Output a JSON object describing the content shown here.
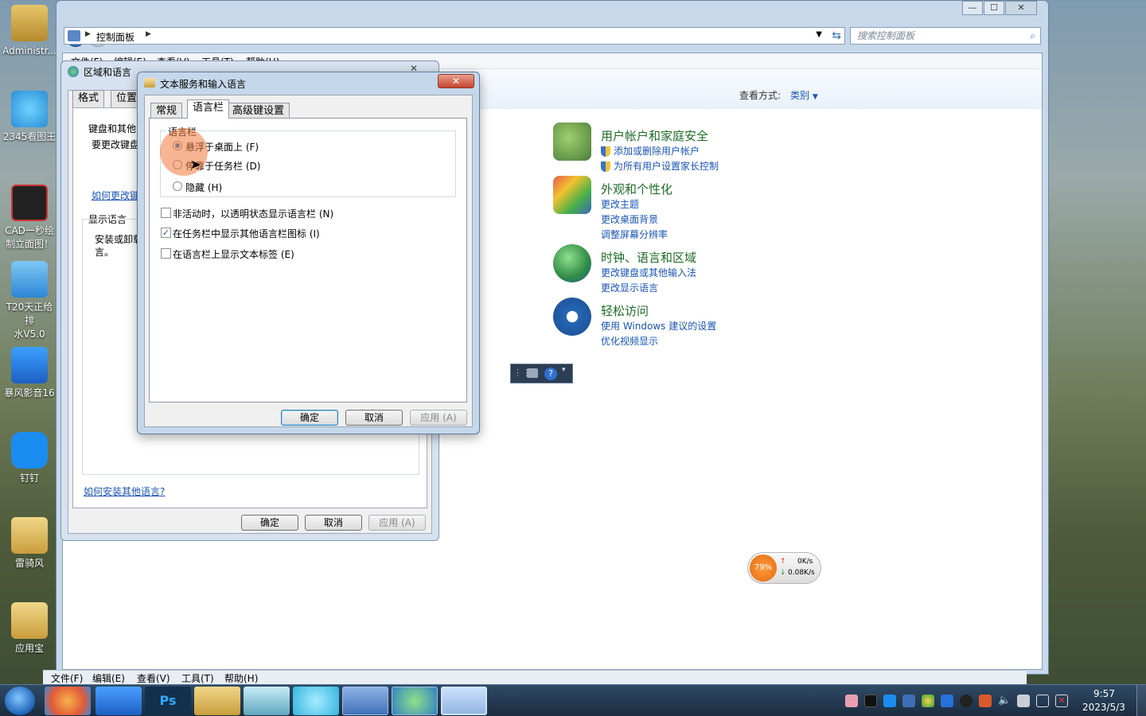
{
  "desktop": {
    "icons": [
      {
        "label": "Administr...",
        "color": "#c9a24a"
      },
      {
        "label": "2345看图王",
        "color": "#36a7e6"
      },
      {
        "label": "CAD一秒绘\n制立面图！",
        "color": "#222222"
      },
      {
        "label": "T20天正给排\n水V5.0",
        "color": "#2d86d6"
      },
      {
        "label": "暴风影音16",
        "color": "#1e73d6"
      },
      {
        "label": "钉钉",
        "color": "#1a8cf0"
      },
      {
        "label": "雷骑风",
        "color": "#d9b65a"
      },
      {
        "label": "应用宝",
        "color": "#d9b65a"
      }
    ]
  },
  "control_panel": {
    "address": "控制面板",
    "search_placeholder": "搜索控制面板",
    "menu": [
      "文件(F)",
      "编辑(E)",
      "查看(V)",
      "工具(T)",
      "帮助(H)"
    ],
    "view_by_label": "查看方式:",
    "view_by_value": "类别",
    "categories": [
      {
        "title": "用户帐户和家庭安全",
        "links": [
          "添加或删除用户帐户",
          "为所有用户设置家长控制"
        ],
        "color": "#4a7c3a"
      },
      {
        "title": "外观和个性化",
        "links": [
          "更改主题",
          "更改桌面背景",
          "调整屏幕分辨率"
        ],
        "color": "#3a66b8"
      },
      {
        "title": "时钟、语言和区域",
        "links": [
          "更改键盘或其他输入法",
          "更改显示语言"
        ],
        "color": "#2f8a46"
      },
      {
        "title": "轻松访问",
        "links": [
          "使用 Windows 建议的设置",
          "优化视频显示"
        ],
        "color": "#2566b4"
      }
    ],
    "network_widget": {
      "percent": "79%",
      "up": "0K/s",
      "down": "0.08K/s"
    }
  },
  "region_window": {
    "title": "区域和语言",
    "tabs": [
      "格式",
      "位置"
    ],
    "keyboard_group": "键盘和其他",
    "keyboard_text": "要更改键盘",
    "keyboard_link": "如何更改键",
    "display_group": "显示语言",
    "display_text": "安装或卸载\n言。",
    "install_link": "如何安装其他语言?",
    "ok": "确定",
    "cancel": "取消",
    "apply": "应用 (A)"
  },
  "text_services": {
    "title": "文本服务和输入语言",
    "tabs": [
      "常规",
      "语言栏",
      "高级键设置"
    ],
    "group": "语言栏",
    "radios": [
      {
        "label": "悬浮于桌面上 (F)",
        "checked": true
      },
      {
        "label": "停靠于任务栏 (D)",
        "checked": false
      },
      {
        "label": "隐藏 (H)",
        "checked": false
      }
    ],
    "checkboxes": [
      {
        "label": "非活动时，以透明状态显示语言栏 (N)",
        "checked": false
      },
      {
        "label": "在任务栏中显示其他语言栏图标 (I)",
        "checked": true
      },
      {
        "label": "在语言栏上显示文本标签 (E)",
        "checked": false
      }
    ],
    "ok": "确定",
    "cancel": "取消",
    "apply": "应用 (A)"
  },
  "bottom_menu": [
    "文件(F)",
    "编辑(E)",
    "查看(V)",
    "工具(T)",
    "帮助(H)"
  ],
  "taskbar": {
    "apps": [
      {
        "name": "start",
        "color": "#2f8bd8"
      },
      {
        "name": "360",
        "color": "#e25a3a"
      },
      {
        "name": "baofeng",
        "color": "#2672d8"
      },
      {
        "name": "photoshop",
        "color": "#13304d"
      },
      {
        "name": "explorer",
        "color": "#d9b35a"
      },
      {
        "name": "notepad",
        "color": "#77b3c8"
      },
      {
        "name": "2345viewer",
        "color": "#37b5e0"
      },
      {
        "name": "control-panel",
        "color": "#5a86c4"
      },
      {
        "name": "region",
        "color": "#3f8ad1"
      },
      {
        "name": "text-services",
        "color": "#4c8fd8"
      }
    ],
    "time": "9:57",
    "date": "2023/5/3"
  }
}
